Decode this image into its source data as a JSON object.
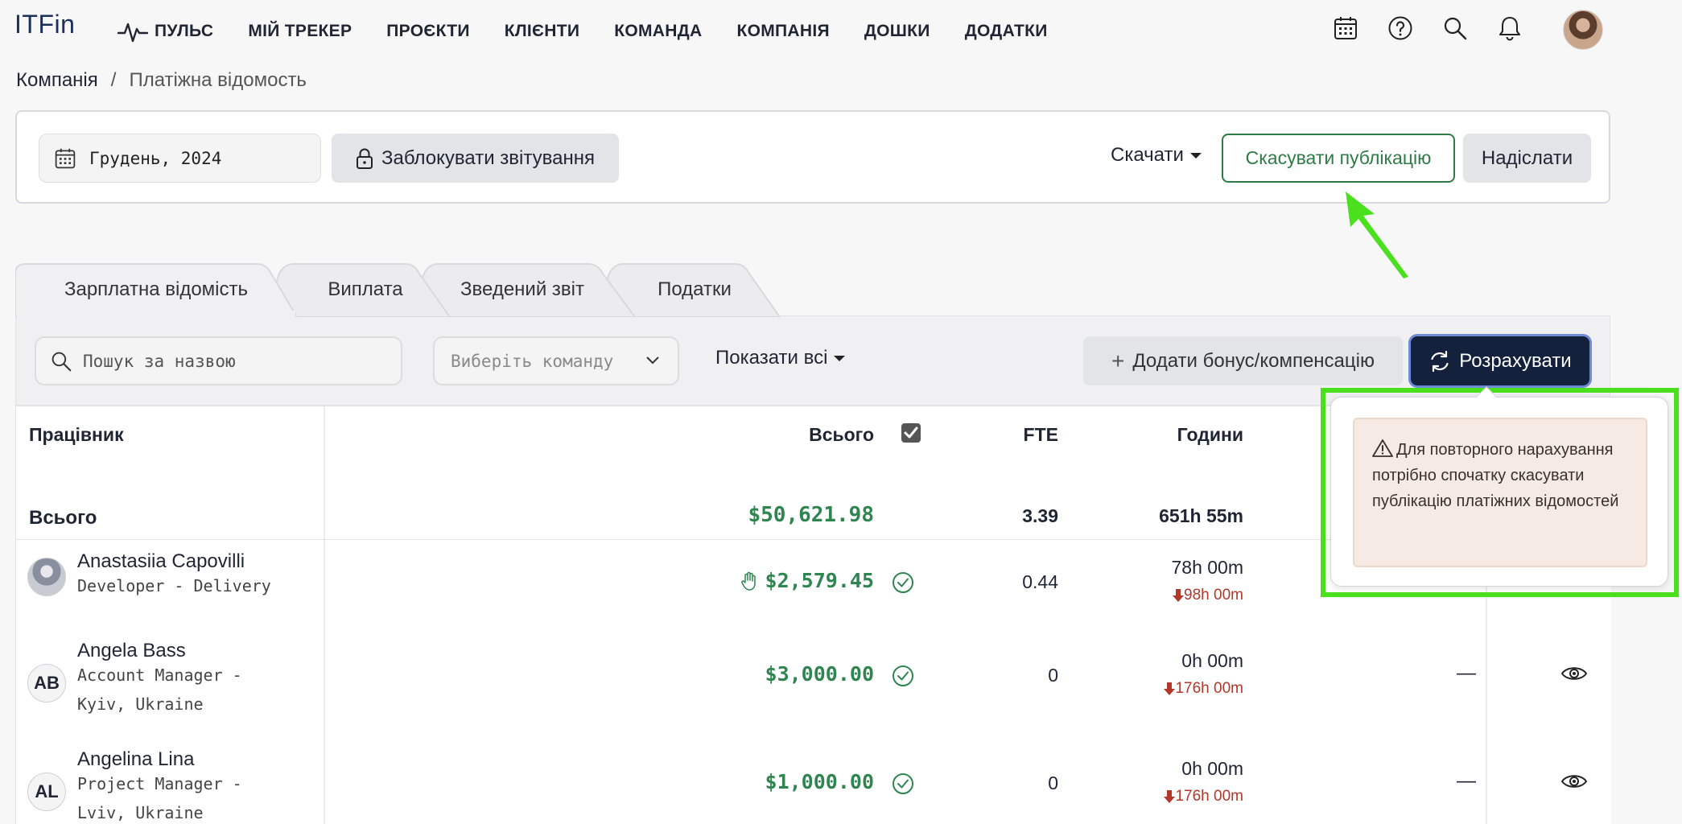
{
  "app": {
    "logo": "ITFin"
  },
  "nav": {
    "items": [
      {
        "label": "ПУЛЬС"
      },
      {
        "label": "МІЙ ТРЕКЕР"
      },
      {
        "label": "ПРОЄКТИ"
      },
      {
        "label": "КЛІЄНТИ"
      },
      {
        "label": "КОМАНДА"
      },
      {
        "label": "КОМПАНІЯ"
      },
      {
        "label": "ДОШКИ"
      },
      {
        "label": "ДОДАТКИ"
      }
    ],
    "icons": [
      "calendar-icon",
      "help-icon",
      "search-icon",
      "bell-icon"
    ]
  },
  "breadcrumb": {
    "root": "Компанія",
    "separator": "/",
    "current": "Платіжна відомость"
  },
  "toolbar": {
    "period": "Грудень, 2024",
    "lock_label": "Заблокувати звітування",
    "download_label": "Скачати",
    "unpublish_label": "Скасувати публікацію",
    "send_label": "Надіслати"
  },
  "tabs": [
    {
      "label": "Зарплатна відомість",
      "active": true
    },
    {
      "label": "Виплата",
      "active": false
    },
    {
      "label": "Зведений звіт",
      "active": false
    },
    {
      "label": "Податки",
      "active": false
    }
  ],
  "filters": {
    "search_placeholder": "Пошук за назвою",
    "team_placeholder": "Виберіть команду",
    "show_all_label": "Показати всі",
    "add_bonus_label": "Додати бонус/компенсацію",
    "calculate_label": "Розрахувати"
  },
  "table": {
    "headers": {
      "employee": "Працівник",
      "total": "Всього",
      "fte": "FTE",
      "hours": "Години"
    },
    "totals": {
      "label": "Всього",
      "amount": "$50,621.98",
      "fte": "3.39",
      "hours": "651h 55m"
    },
    "rows": [
      {
        "name": "Anastasiia Capovilli",
        "role": "Developer - Delivery",
        "initials": "",
        "amount": "$2,579.45",
        "manual": true,
        "fte": "0.44",
        "hours": "78h 00m",
        "hours_diff": "98h 00m",
        "extra": ""
      },
      {
        "name": "Angela Bass",
        "role": "Account Manager - Kyiv, Ukraine",
        "initials": "AB",
        "amount": "$3,000.00",
        "manual": false,
        "fte": "0",
        "hours": "0h 00m",
        "hours_diff": "176h 00m",
        "extra": "—"
      },
      {
        "name": "Angelina Lina",
        "role": "Project Manager - Lviv, Ukraine",
        "initials": "AL",
        "amount": "$1,000.00",
        "manual": false,
        "fte": "0",
        "hours": "0h 00m",
        "hours_diff": "176h 00m",
        "extra": "—"
      }
    ]
  },
  "popover": {
    "message": "Для повторного нарахування потрібно спочатку скасувати публікацію платіжних відомостей"
  },
  "colors": {
    "accent_green": "#2e8550",
    "primary_dark": "#13213c",
    "highlight": "#4be01e",
    "negative": "#b3372b"
  }
}
